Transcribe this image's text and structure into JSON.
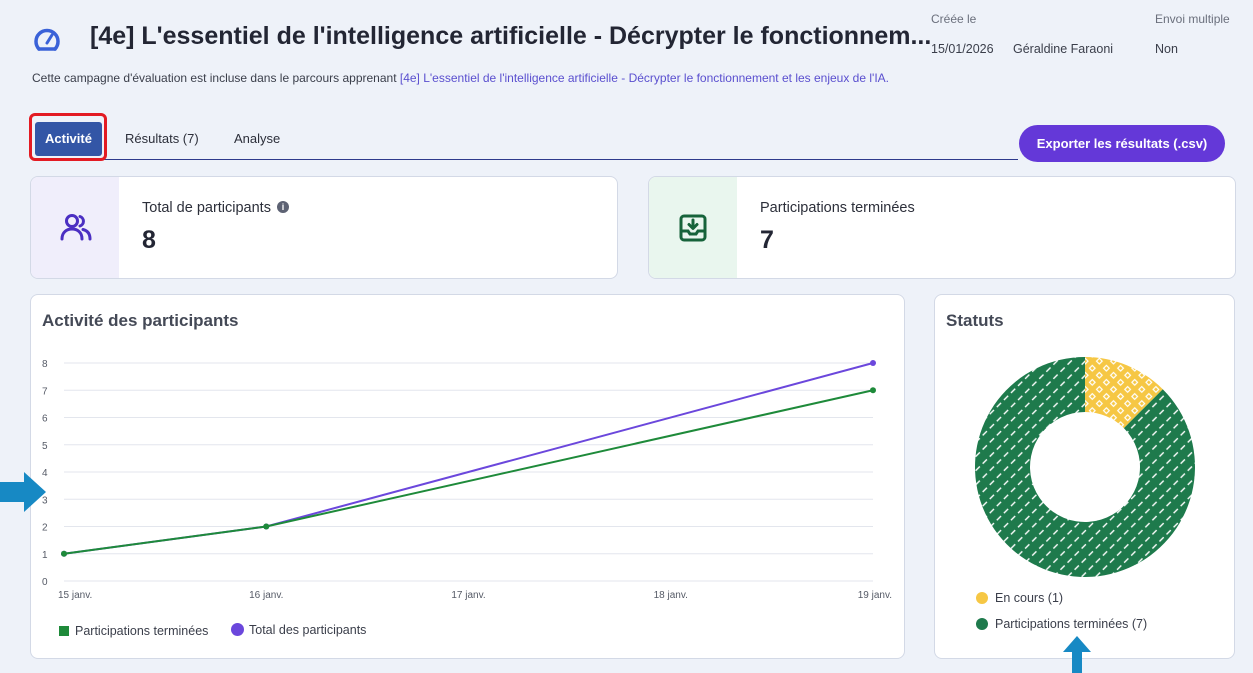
{
  "header": {
    "title": "[4e] L'essentiel de l'intelligence artificielle - Décrypter le fonctionnem...",
    "created_label": "Créée le",
    "created_date": "15/01/2026",
    "author": "Géraldine Faraoni",
    "multi_send_label": "Envoi multiple",
    "multi_send_value": "Non",
    "description_prefix": "Cette campagne d'évaluation est incluse dans le parcours apprenant ",
    "description_link": "[4e] L'essentiel de l'intelligence artificielle - Décrypter le fonctionnement et les enjeux de l'IA.",
    "icon": "gauge-icon"
  },
  "tabs": [
    {
      "label": "Activité",
      "active": true
    },
    {
      "label": "Résultats (7)",
      "active": false
    },
    {
      "label": "Analyse",
      "active": false
    }
  ],
  "export_button": "Exporter les résultats (.csv)",
  "stats": {
    "total": {
      "label": "Total de participants",
      "value": "8",
      "icon": "users-icon",
      "info_icon": "i"
    },
    "done": {
      "label": "Participations terminées",
      "value": "7",
      "icon": "inbox-download-icon"
    }
  },
  "activity_panel": {
    "title": "Activité des participants"
  },
  "status_panel": {
    "title": "Statuts",
    "legend": [
      {
        "label": "En cours (1)",
        "color": "#f6c744"
      },
      {
        "label": "Participations terminées (7)",
        "color": "#1e7a4c"
      }
    ]
  },
  "colors": {
    "accent": "#6438d8",
    "tab_active": "#3356a6",
    "green": "#1e8a3a",
    "purple": "#6b47dc",
    "donut_green": "#1e7a4c",
    "donut_yellow": "#f6c744",
    "highlight": "#e31b23",
    "arrow": "#1789c4"
  },
  "chart_data": [
    {
      "type": "line",
      "x": [
        "15 janv.",
        "16 janv.",
        "17 janv.",
        "18 janv.",
        "19 janv."
      ],
      "ylim": [
        0,
        8
      ],
      "yticks": [
        "0",
        "1",
        "2",
        "3",
        "4",
        "5",
        "6",
        "7",
        "8"
      ],
      "grid": true,
      "legend_position": "bottom-left",
      "series": [
        {
          "name": "Participations terminées",
          "color": "#1e8a3a",
          "points": [
            {
              "x": "15 janv.",
              "y": 1
            },
            {
              "x": "16 janv.",
              "y": 2
            },
            {
              "x": "19 janv.",
              "y": 7
            }
          ]
        },
        {
          "name": "Total des participants",
          "color": "#6b47dc",
          "points": [
            {
              "x": "15 janv.",
              "y": 1
            },
            {
              "x": "16 janv.",
              "y": 2
            },
            {
              "x": "19 janv.",
              "y": 8
            }
          ]
        }
      ]
    },
    {
      "type": "pie",
      "donut": true,
      "categories": [
        "En cours",
        "Participations terminées"
      ],
      "values": [
        1,
        7
      ],
      "colors": [
        "#f6c744",
        "#1e7a4c"
      ]
    }
  ]
}
